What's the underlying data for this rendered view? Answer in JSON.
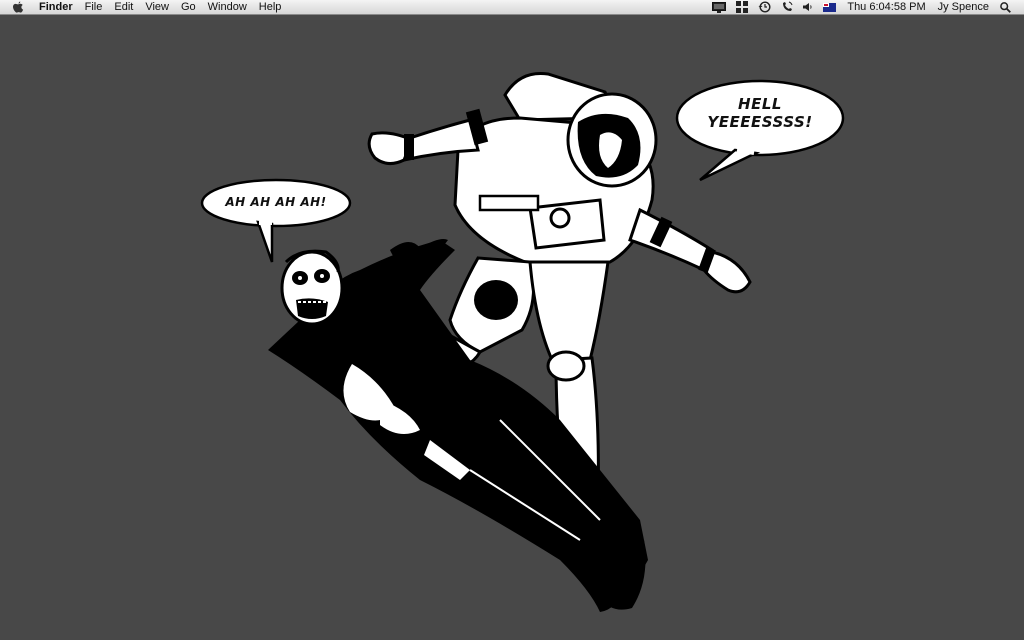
{
  "menubar": {
    "app_name": "Finder",
    "menus": [
      "File",
      "Edit",
      "View",
      "Go",
      "Window",
      "Help"
    ],
    "status_icons": [
      "display-mirroring-icon",
      "spaces-icon",
      "time-machine-icon",
      "bluetooth-phone-icon",
      "volume-icon",
      "input-source-flag-icon"
    ],
    "clock": "Thu 6:04:58 PM",
    "user": "Jy Spence"
  },
  "wallpaper": {
    "bubble_zombie": "AH AH AH AH!",
    "bubble_astronaut_line1": "HELL",
    "bubble_astronaut_line2": "YEEEESSSS!"
  },
  "colors": {
    "desktop_background": "#484848",
    "menubar_top": "#f4f4f4",
    "menubar_bottom": "#d6d6d6"
  }
}
